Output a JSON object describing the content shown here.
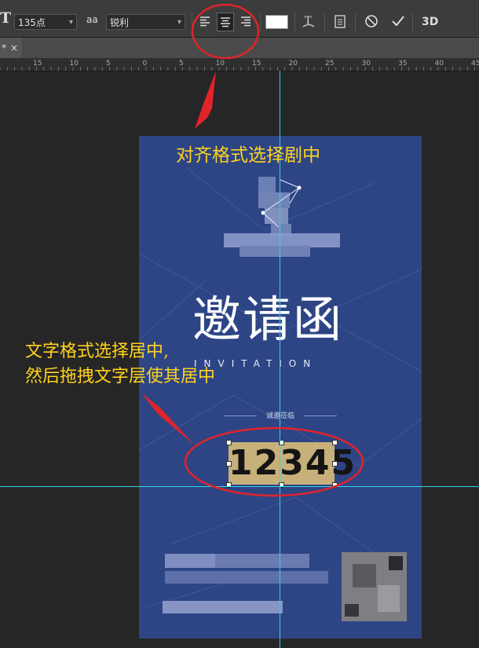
{
  "toolbar": {
    "font_size": "135点",
    "antialias_icon": "aa",
    "antialias_mode": "锐利",
    "align_left": "align-left-icon",
    "align_center": "align-center-icon",
    "align_right": "align-right-icon",
    "text_color": "#ffffff",
    "warp_icon": "warp-text-icon",
    "panels_icon": "character-panel-icon",
    "cancel_icon": "cancel-icon",
    "commit_icon": "commit-icon",
    "threed_label": "3D"
  },
  "document_tab": {
    "label": "*",
    "close": "×"
  },
  "ruler": {
    "ticks": [
      "15",
      "10",
      "5",
      "0",
      "5",
      "10",
      "15",
      "20",
      "25",
      "30",
      "35",
      "40",
      "45"
    ]
  },
  "poster": {
    "title": "邀请函",
    "subtitle": "INVITATION",
    "invite_line": "诚邀莅临",
    "number": "12345",
    "background": "#2d4585"
  },
  "annotations": {
    "top": "对齐格式选择剧中",
    "bottom_line1": "文字格式选择居中,",
    "bottom_line2": "然后拖拽文字层使其居中",
    "color": "#ffd21f",
    "ellipse_color": "#e0242a"
  }
}
